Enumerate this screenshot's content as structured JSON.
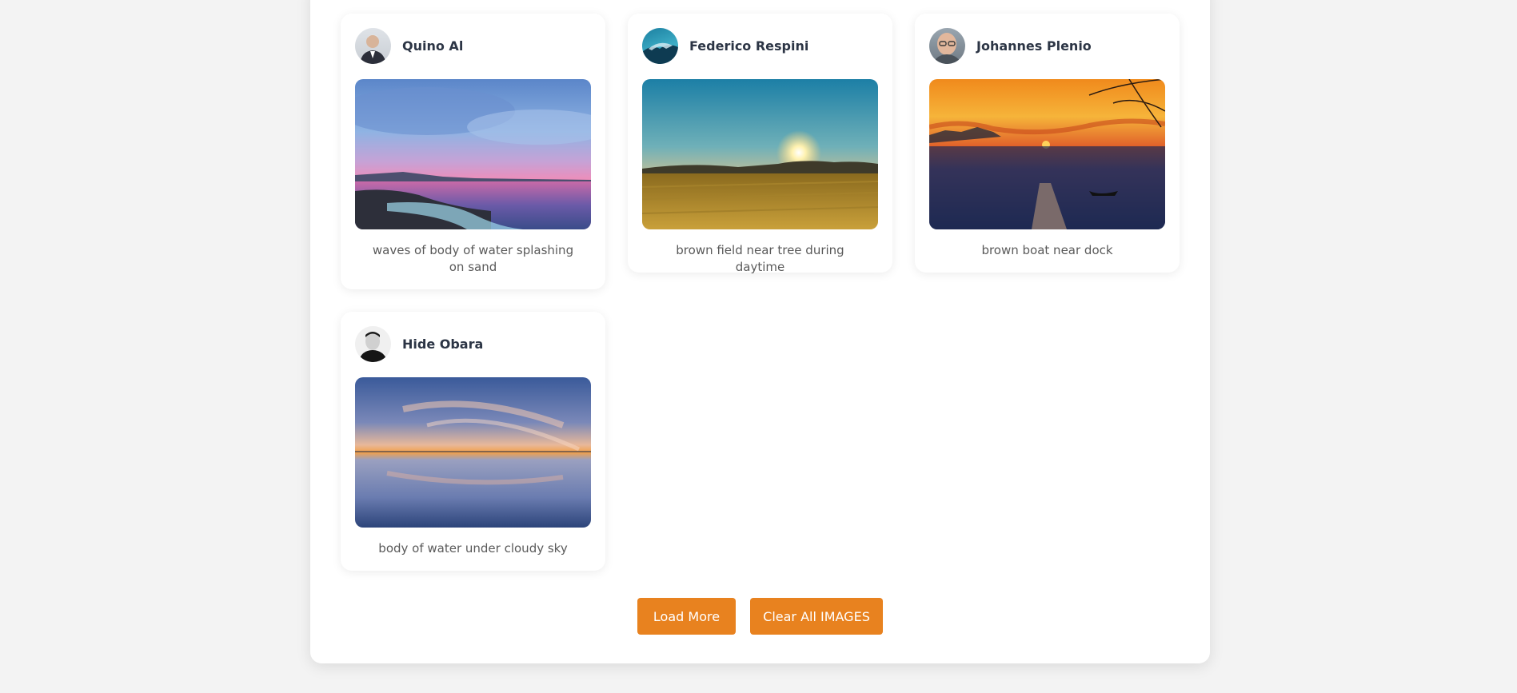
{
  "cards": [
    {
      "author": "Quino Al",
      "caption": "waves of body of water splashing on sand",
      "avatar_icon": "person-portrait-icon",
      "photo": "beach-sunset-photo"
    },
    {
      "author": "Federico Respini",
      "caption": "brown field near tree during daytime",
      "avatar_icon": "landscape-avatar-icon",
      "photo": "field-sunset-photo"
    },
    {
      "author": "Johannes Plenio",
      "caption": "brown boat near dock",
      "avatar_icon": "person-portrait-icon",
      "photo": "dock-sunset-photo"
    },
    {
      "author": "Hide Obara",
      "caption": "body of water under cloudy sky",
      "avatar_icon": "person-portrait-icon",
      "photo": "lake-sunset-photo"
    }
  ],
  "actions": {
    "load_more_label": "Load More",
    "clear_all_label": "Clear All IMAGES"
  },
  "colors": {
    "accent": "#e8821f",
    "background": "#f3f3f3",
    "author_text": "#2c3545",
    "caption_text": "#5a5a5a"
  }
}
